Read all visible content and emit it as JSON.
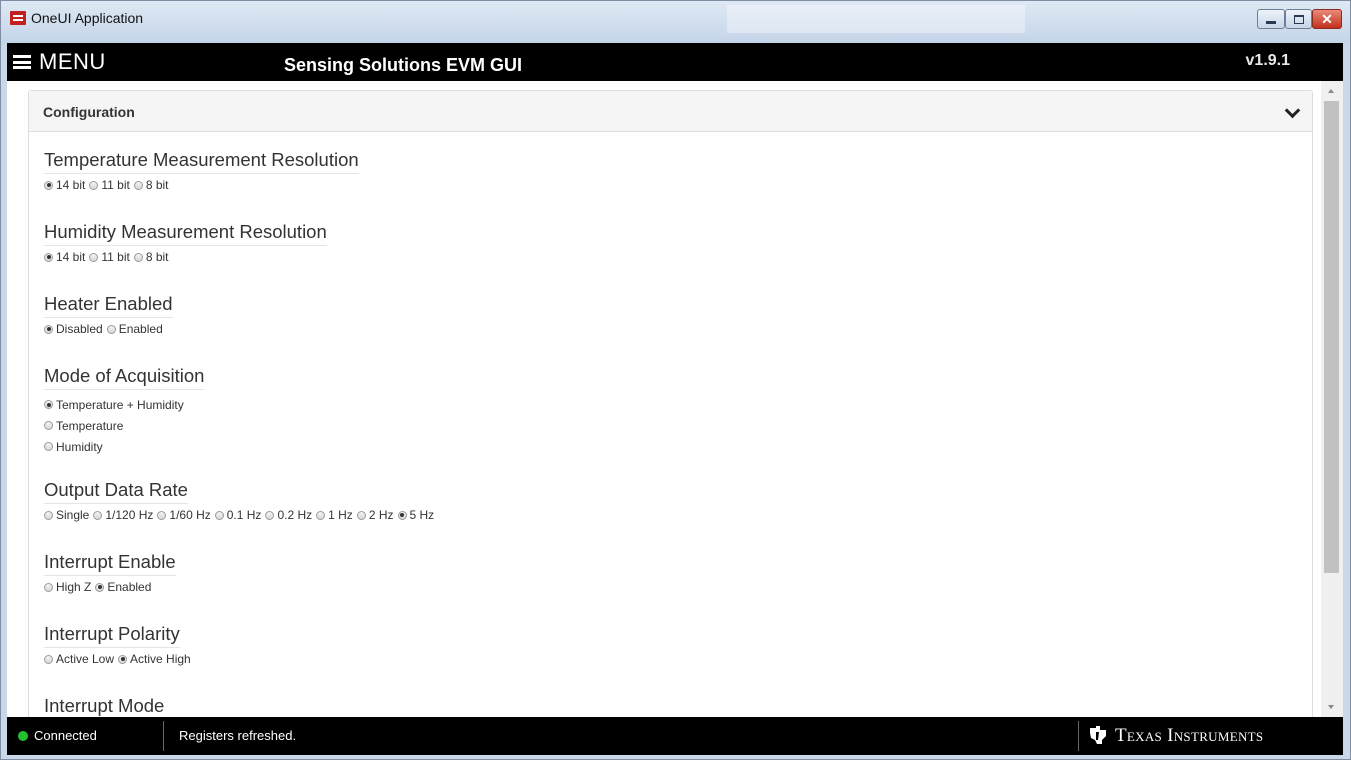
{
  "window": {
    "title": "OneUI Application",
    "icon": "oneui-app-icon",
    "controls": [
      "minimize-icon",
      "maximize-icon",
      "close-icon"
    ]
  },
  "header": {
    "menu_label": "MENU",
    "app_title": "Sensing Solutions EVM GUI",
    "version": "v1.9.1"
  },
  "panel": {
    "title": "Configuration",
    "collapse_icon": "chevron-down-icon"
  },
  "sections": {
    "temp_res": {
      "title": "Temperature Measurement Resolution",
      "options": [
        "14 bit",
        "11 bit",
        "8 bit"
      ],
      "selected": "14 bit"
    },
    "hum_res": {
      "title": "Humidity Measurement Resolution",
      "options": [
        "14 bit",
        "11 bit",
        "8 bit"
      ],
      "selected": "14 bit"
    },
    "heater": {
      "title": "Heater Enabled",
      "options": [
        "Disabled",
        "Enabled"
      ],
      "selected": "Disabled"
    },
    "mode": {
      "title": "Mode of Acquisition",
      "options": [
        "Temperature + Humidity",
        "Temperature",
        "Humidity"
      ],
      "selected": "Temperature + Humidity"
    },
    "odr": {
      "title": "Output Data Rate",
      "options": [
        "Single",
        "1/120 Hz",
        "1/60 Hz",
        "0.1 Hz",
        "0.2 Hz",
        "1 Hz",
        "2 Hz",
        "5 Hz"
      ],
      "selected": "5 Hz"
    },
    "int_enable": {
      "title": "Interrupt Enable",
      "options": [
        "High Z",
        "Enabled"
      ],
      "selected": "Enabled"
    },
    "int_polarity": {
      "title": "Interrupt Polarity",
      "options": [
        "Active Low",
        "Active High"
      ],
      "selected": "Active High"
    },
    "int_mode": {
      "title": "Interrupt Mode"
    }
  },
  "status": {
    "connection": "Connected",
    "connection_color": "#22c22e",
    "message": "Registers refreshed.",
    "brand": "Texas Instruments"
  }
}
